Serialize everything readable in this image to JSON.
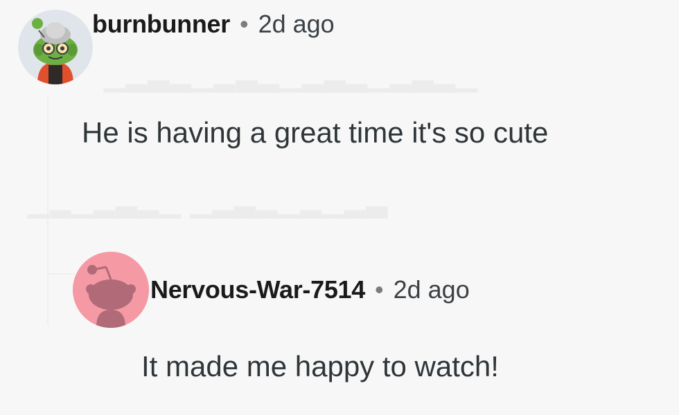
{
  "comments": [
    {
      "author": "burnbunner",
      "separator": "•",
      "time": "2d ago",
      "body": "He is having a great time it's so cute",
      "avatar_icon": "goblin-snoo-avatar-icon"
    },
    {
      "author": "Nervous-War-7514",
      "separator": "•",
      "time": "2d ago",
      "body": "It made me happy to watch!",
      "avatar_icon": "default-snoo-avatar-icon"
    }
  ],
  "colors": {
    "background": "#f7f7f7",
    "avatar2_bg": "#f59aa4",
    "avatar2_figure": "#b06a78"
  }
}
